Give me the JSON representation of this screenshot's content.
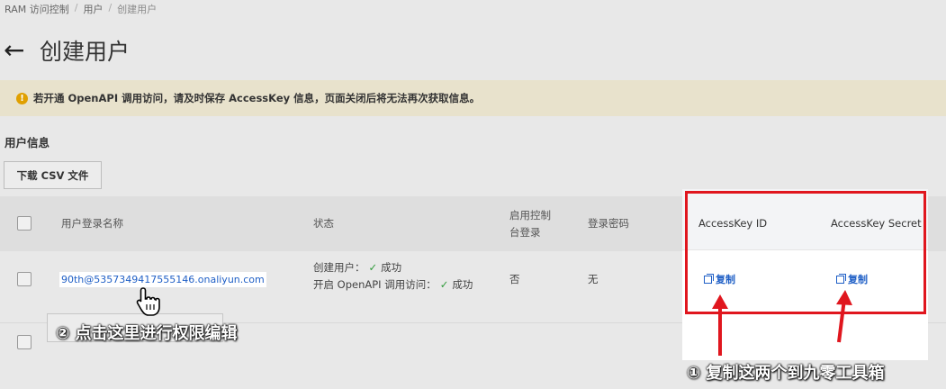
{
  "breadcrumb": {
    "root": "RAM 访问控制",
    "sep": "/",
    "users": "用户",
    "current": "创建用户"
  },
  "page": {
    "back_glyph": "←",
    "title": "创建用户"
  },
  "warning": {
    "icon": "!",
    "text": "若开通 OpenAPI 调用访问，请及时保存 AccessKey 信息，页面关闭后将无法再次获取信息。"
  },
  "section": {
    "title": "用户信息"
  },
  "toolbar": {
    "download_csv": "下载 CSV 文件"
  },
  "table": {
    "headers": {
      "login_name": "用户登录名称",
      "status": "状态",
      "console_login_line1": "启用控制",
      "console_login_line2": "台登录",
      "password": "登录密码",
      "access_key_id": "AccessKey ID",
      "access_key_secret": "AccessKey Secret"
    },
    "row": {
      "login_name": "90th@5357349417555146.onaliyun.com",
      "status_create_label": "创建用户：",
      "status_create_value": "成功",
      "status_api_label": "开启 OpenAPI 调用访问：",
      "status_api_value": "成功",
      "console_login": "否",
      "password": "无",
      "copy_id": "复制",
      "copy_secret": "复制"
    }
  },
  "annotations": {
    "step1": "① 复制这两个到九零工具箱",
    "step2": "② 点击这里进行权限编辑"
  },
  "colors": {
    "accent": "#e0161e",
    "link": "#1f5fc6",
    "success": "#2f9a3a",
    "warning": "#e0a000"
  }
}
